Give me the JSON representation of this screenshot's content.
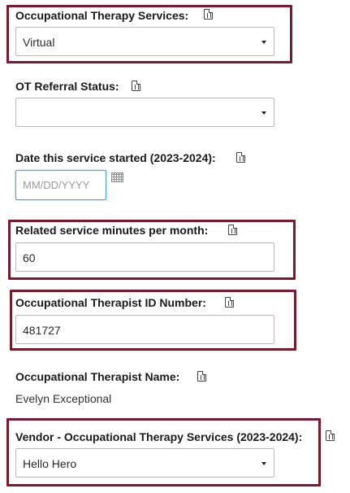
{
  "fields": {
    "ot_services": {
      "label": "Occupational Therapy Services:",
      "value": "Virtual"
    },
    "ot_referral_status": {
      "label": "OT Referral Status:",
      "value": ""
    },
    "date_started": {
      "label": "Date this service started (2023-2024):",
      "placeholder": "MM/DD/YYYY"
    },
    "related_minutes": {
      "label": "Related service minutes per month:",
      "value": "60"
    },
    "therapist_id": {
      "label": "Occupational Therapist ID Number:",
      "value": "481727"
    },
    "therapist_name": {
      "label": "Occupational Therapist Name:",
      "value": "Evelyn Exceptional"
    },
    "vendor": {
      "label": "Vendor - Occupational Therapy Services (2023-2024):",
      "value": "Hello Hero"
    }
  },
  "icons": {
    "field_info": "document-icon",
    "calendar": "calendar-icon",
    "dropdown": "chevron-down-icon"
  },
  "colors": {
    "highlight_border": "#7a1a2c",
    "focus_border": "#4aa3df"
  }
}
